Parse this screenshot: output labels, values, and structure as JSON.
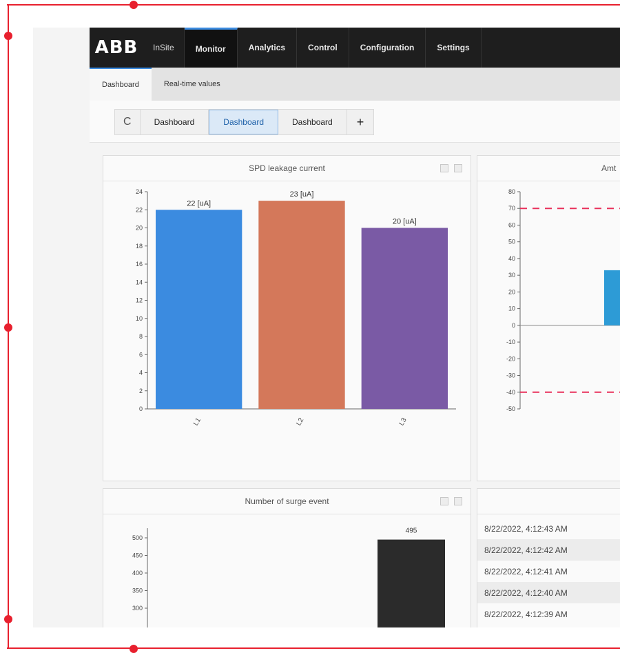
{
  "app": {
    "brand": "ABB",
    "product": "InSite",
    "nav": [
      "Monitor",
      "Analytics",
      "Control",
      "Configuration",
      "Settings"
    ],
    "subtabs": [
      "Dashboard",
      "Real-time values"
    ],
    "dashboard_tabs": [
      "Dashboard",
      "Dashboard",
      "Dashboard"
    ],
    "add_tab_label": "+",
    "history_icon": "C"
  },
  "panels": {
    "spd_title": "SPD leakage current",
    "ambient_title": "Amt",
    "surge_title": "Number of surge event"
  },
  "timestamps": [
    "8/22/2022, 4:12:43 AM",
    "8/22/2022, 4:12:42 AM",
    "8/22/2022, 4:12:41 AM",
    "8/22/2022, 4:12:40 AM",
    "8/22/2022, 4:12:39 AM"
  ],
  "colors": {
    "accent": "#3b8be0",
    "bar1": "#3b8be0",
    "bar2": "#d4785a",
    "bar3": "#7a5aa5",
    "ambient_bar": "#2d9bd6",
    "threshold": "#e8305a",
    "surge_bar": "#2b2b2b"
  },
  "chart_data": [
    {
      "type": "bar",
      "title": "SPD leakage current",
      "categories": [
        "L1",
        "L2",
        "L3"
      ],
      "values": [
        22,
        23,
        20
      ],
      "data_labels": [
        "22 [uA]",
        "23 [uA]",
        "20 [uA]"
      ],
      "ylim": [
        0,
        24
      ],
      "yticks": [
        "0",
        "2",
        "4",
        "6",
        "8",
        "10",
        "12",
        "14",
        "16",
        "18",
        "20",
        "22",
        "24"
      ]
    },
    {
      "type": "bar",
      "title": "Amt",
      "values": [
        33
      ],
      "ylim": [
        -50,
        80
      ],
      "yticks": [
        "80",
        "70",
        "60",
        "50",
        "40",
        "30",
        "20",
        "10",
        "0",
        "-10",
        "-20",
        "-30",
        "-40",
        "-50"
      ],
      "thresholds": [
        70,
        -40
      ]
    },
    {
      "type": "bar",
      "title": "Number of surge event",
      "values": [
        495
      ],
      "data_labels": [
        "495"
      ],
      "yticks": [
        "500",
        "450",
        "400",
        "350",
        "300"
      ]
    }
  ]
}
